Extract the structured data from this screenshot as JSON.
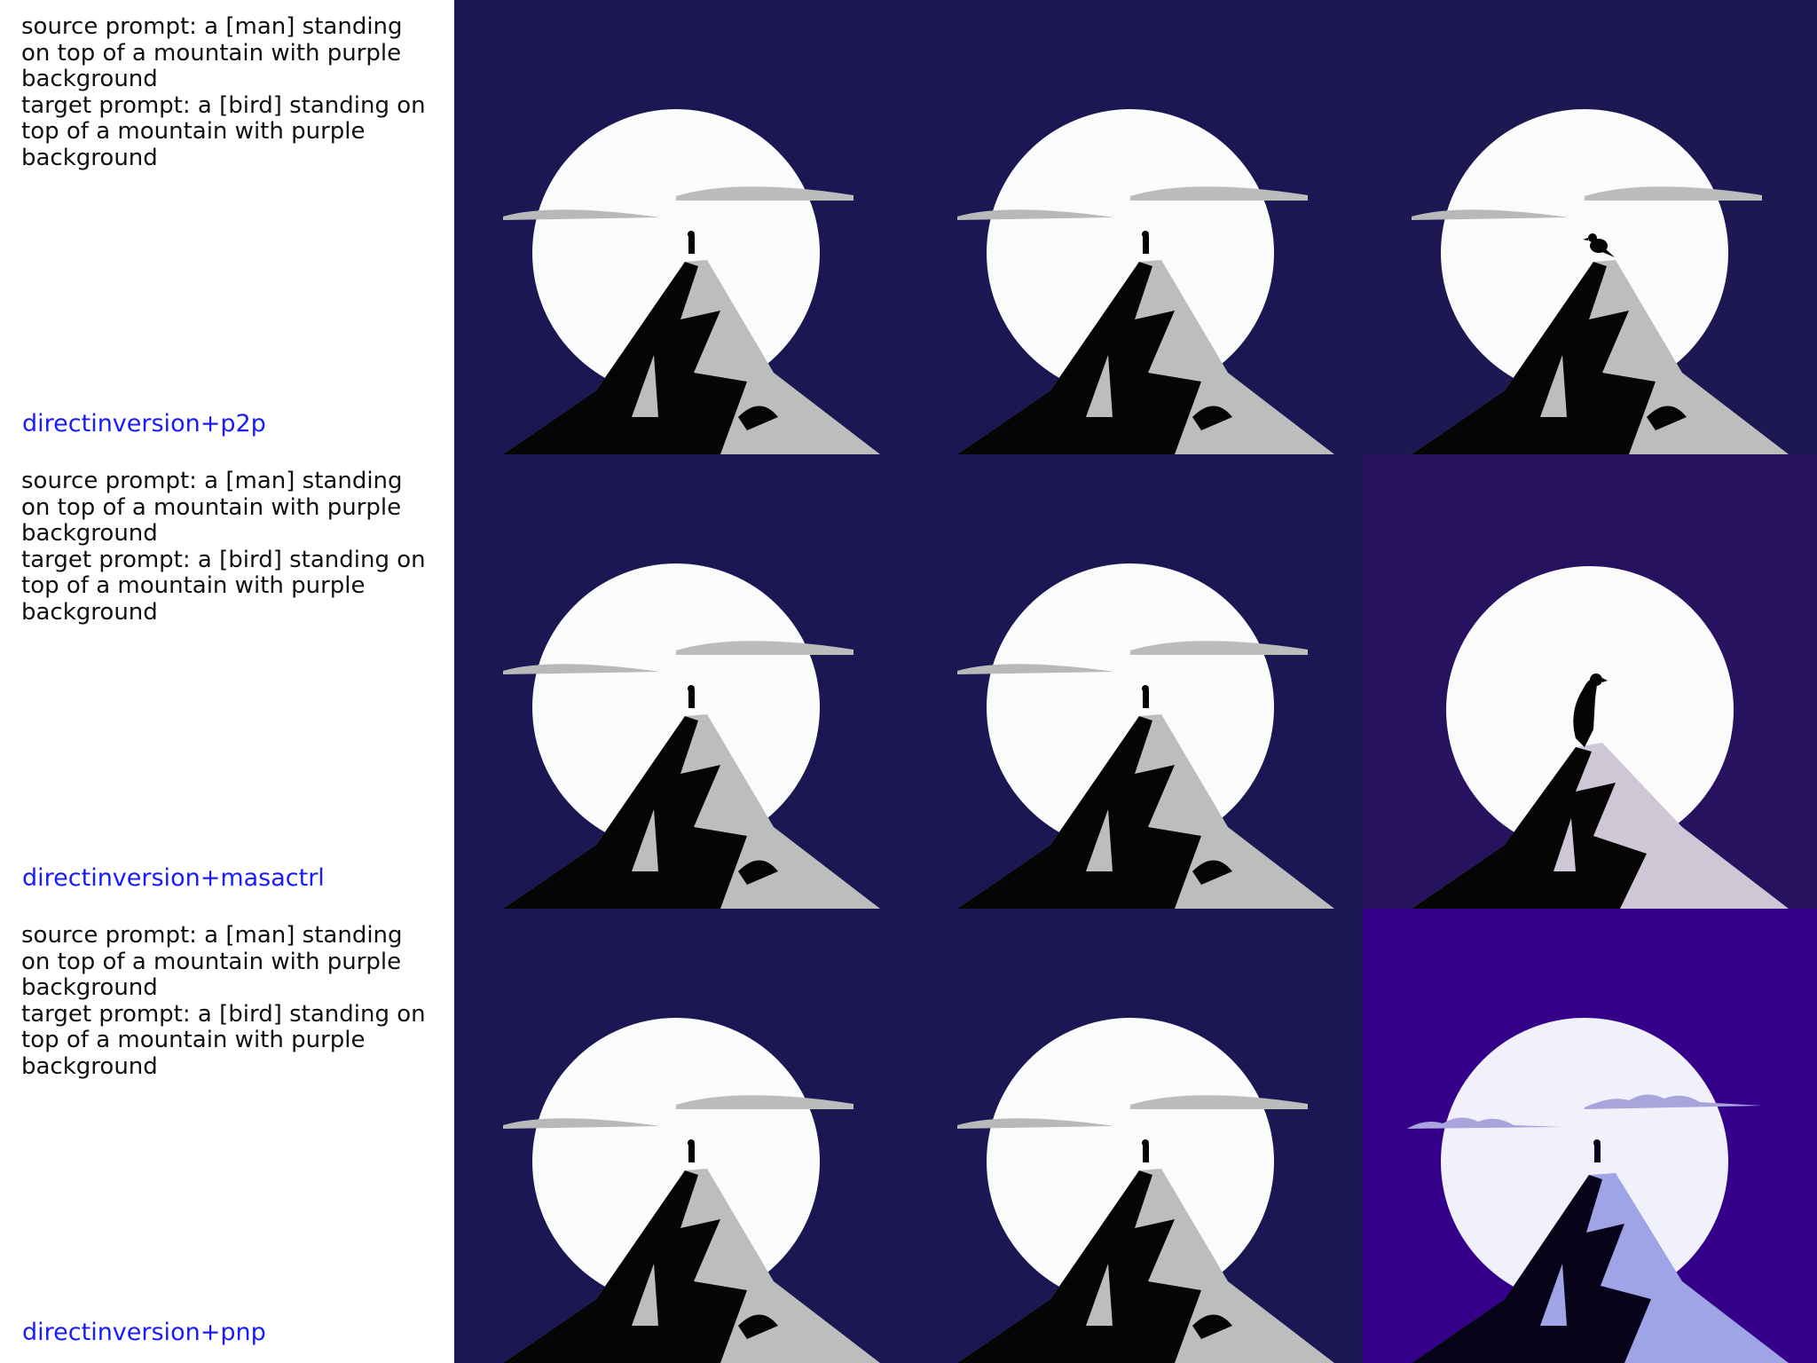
{
  "rows": [
    {
      "source_prompt": "source prompt: a [man] standing on top of a mountain with purple background",
      "target_prompt": "target prompt: a [bird] standing on top of a mountain with purple background",
      "method": "directinversion+p2p"
    },
    {
      "source_prompt": "source prompt: a [man] standing on top of a mountain with purple background",
      "target_prompt": "target prompt: a [bird] standing on top of a mountain with purple background",
      "method": "directinversion+masactrl"
    },
    {
      "source_prompt": "source prompt: a [man] standing on top of a mountain with purple background",
      "target_prompt": "target prompt: a [bird] standing on top of a mountain with purple background",
      "method": "directinversion+pnp"
    }
  ],
  "colors": {
    "bg_dark_navy": "#1a1650",
    "bg_violet": "#26125e",
    "bg_pnp": "#34008a",
    "moon": "#fbfbfb",
    "rock_light": "#bdbdbd",
    "rock_dark": "#050505",
    "label_blue": "#1a1aff"
  }
}
